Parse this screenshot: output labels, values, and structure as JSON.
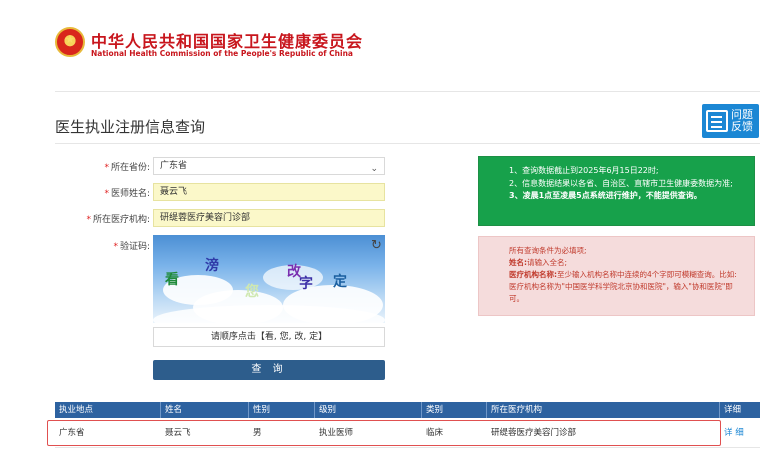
{
  "header": {
    "org_name_cn": "中华人民共和国国家卫生健康委员会",
    "org_name_en": "National Health Commission of the People's Republic of China"
  },
  "page": {
    "title": "医生执业注册信息查询",
    "help_button": "问题\n反馈"
  },
  "form": {
    "province": {
      "label": "所在省份:",
      "value": "广东省"
    },
    "doctor_name": {
      "label": "医师姓名:",
      "value": "聂云飞"
    },
    "institution": {
      "label": "所在医疗机构:",
      "value": "研缇蓉医疗美容门诊部"
    },
    "captcha": {
      "label": "验证码:",
      "chars": [
        "看",
        "滂",
        "您",
        "改",
        "定"
      ],
      "hint": "请顺序点击【看, 您, 改, 定】"
    },
    "query_button": "查 询"
  },
  "notices": {
    "green": [
      "1、查询数据截止到2025年6月15日22时;",
      "2、信息数据结果以各省、自治区、直辖市卫生健康委数据为准;",
      "3、凌晨1点至凌晨5点系统进行维护，不能提供查询。"
    ],
    "red": {
      "line1": "所有查询条件为必填项;",
      "name_label": "姓名:",
      "name_text": "请输入全名;",
      "inst_label": "医疗机构名称:",
      "inst_text": "至少输入机构名称中连续的4个字即可模糊查询。比如: 医疗机构名称为\"中国医学科学院北京协和医院\"，输入\"协和医院\"即可。"
    }
  },
  "table": {
    "columns": [
      "执业地点",
      "姓名",
      "性别",
      "级别",
      "类别",
      "所在医疗机构",
      "详细"
    ],
    "rows": [
      [
        "广东省",
        "聂云飞",
        "男",
        "执业医师",
        "临床",
        "研缇蓉医疗美容门诊部",
        "详 细"
      ]
    ]
  },
  "colors": {
    "brand_red": "#c8161d",
    "table_header": "#2d62a0",
    "notice_green": "#17a14b",
    "notice_red_bg": "#f5dcdc",
    "highlight_border": "#e05050"
  }
}
